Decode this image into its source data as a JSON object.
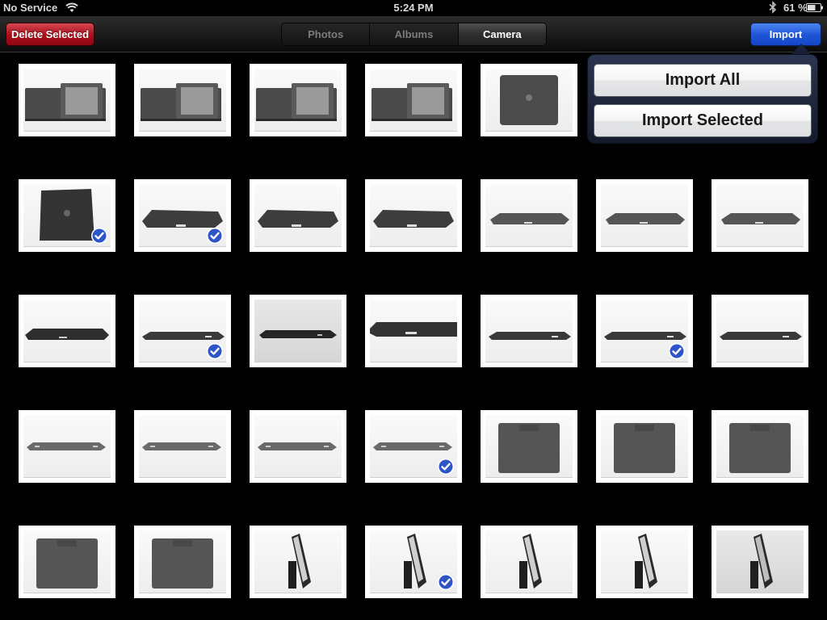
{
  "status_bar": {
    "carrier": "No Service",
    "time": "5:24 PM",
    "battery_percent": "61 %",
    "icons": [
      "wifi-icon",
      "bluetooth-icon",
      "battery-icon"
    ]
  },
  "toolbar": {
    "delete_label": "Delete Selected",
    "tabs": [
      {
        "label": "Photos",
        "active": false
      },
      {
        "label": "Albums",
        "active": false
      },
      {
        "label": "Camera",
        "active": true
      }
    ],
    "import_label": "Import"
  },
  "popover": {
    "import_all_label": "Import All",
    "import_selected_label": "Import Selected"
  },
  "colors": {
    "delete_button": "#a90f1c",
    "import_button": "#1f55d8",
    "checkmark": "#2d55c8"
  },
  "photos": {
    "rows": [
      [
        {
          "kind": "open-case",
          "selected": false
        },
        {
          "kind": "open-case",
          "selected": false
        },
        {
          "kind": "open-case",
          "selected": false
        },
        {
          "kind": "open-case",
          "selected": false
        },
        {
          "kind": "back-case",
          "selected": false
        }
      ],
      [
        {
          "kind": "back-case-tilt",
          "selected": true
        },
        {
          "kind": "side-angle",
          "selected": true
        },
        {
          "kind": "side-angle",
          "selected": false
        },
        {
          "kind": "side-angle",
          "selected": false
        },
        {
          "kind": "side-flat",
          "selected": false
        },
        {
          "kind": "side-flat",
          "selected": false
        },
        {
          "kind": "side-flat",
          "selected": false
        }
      ],
      [
        {
          "kind": "side-flat-dark",
          "selected": false
        },
        {
          "kind": "side-thin",
          "selected": true
        },
        {
          "kind": "side-thin-gray",
          "selected": false
        },
        {
          "kind": "side-closeup",
          "selected": false
        },
        {
          "kind": "side-thin",
          "selected": false
        },
        {
          "kind": "side-thin",
          "selected": true
        },
        {
          "kind": "side-thin",
          "selected": false
        }
      ],
      [
        {
          "kind": "side-edge",
          "selected": false
        },
        {
          "kind": "side-edge",
          "selected": false
        },
        {
          "kind": "side-edge",
          "selected": false
        },
        {
          "kind": "side-edge",
          "selected": true
        },
        {
          "kind": "stand-back",
          "selected": false
        },
        {
          "kind": "stand-back",
          "selected": false
        },
        {
          "kind": "stand-back",
          "selected": false
        }
      ],
      [
        {
          "kind": "stand-back",
          "selected": false
        },
        {
          "kind": "stand-back",
          "selected": false
        },
        {
          "kind": "stand-side",
          "selected": false
        },
        {
          "kind": "stand-side",
          "selected": true
        },
        {
          "kind": "stand-side",
          "selected": false
        },
        {
          "kind": "stand-side",
          "selected": false
        },
        {
          "kind": "stand-side-gray",
          "selected": false
        }
      ]
    ]
  }
}
